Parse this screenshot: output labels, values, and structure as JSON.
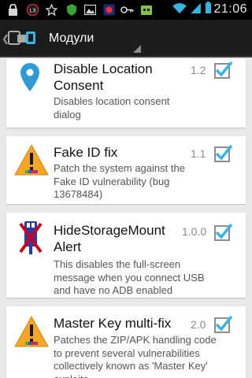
{
  "status_bar": {
    "time": "21:06",
    "icons": [
      "lock-icon",
      "timer-notification-icon",
      "star-icon",
      "security-shield-icon",
      "gallery-icon",
      "app-notification-icon",
      "key-icon",
      "android-debug-icon",
      "wifi-icon",
      "cellular-signal-icon",
      "battery-icon"
    ]
  },
  "action_bar": {
    "title": "Модули",
    "app_icon": "xposed-icon",
    "up_icon": "chevron-left-icon"
  },
  "modules": [
    {
      "title": "Disable Location Consent",
      "version": "1.2",
      "description": "Disables location consent dialog",
      "checked": true,
      "icon": "location-pin-icon"
    },
    {
      "title": "Fake ID fix",
      "version": "1.1",
      "description": "Patch the system against the Fake ID vulnerability (bug 13678484)",
      "checked": true,
      "icon": "warning-android-icon"
    },
    {
      "title": "HideStorageMount Alert",
      "version": "1.0.0",
      "description": "This disables the full-screen message when you connect USB and have no ADB enabled",
      "checked": true,
      "icon": "usb-blocked-icon"
    },
    {
      "title": "Master Key multi-fix",
      "version": "2.0",
      "description": "Patches the ZIP/APK handling code to prevent several vulnerabilities collectively known as 'Master Key' exploits",
      "checked": true,
      "icon": "warning-android-icon"
    }
  ],
  "colors": {
    "check": "#33b5e5",
    "status_bar": "#000000",
    "action_bar": "#1c1c1c",
    "list_background": "#e9e9e9",
    "warning": "#f5a623",
    "location_pin": "#2e9bd6",
    "usb_blocked": "#d0021b"
  }
}
